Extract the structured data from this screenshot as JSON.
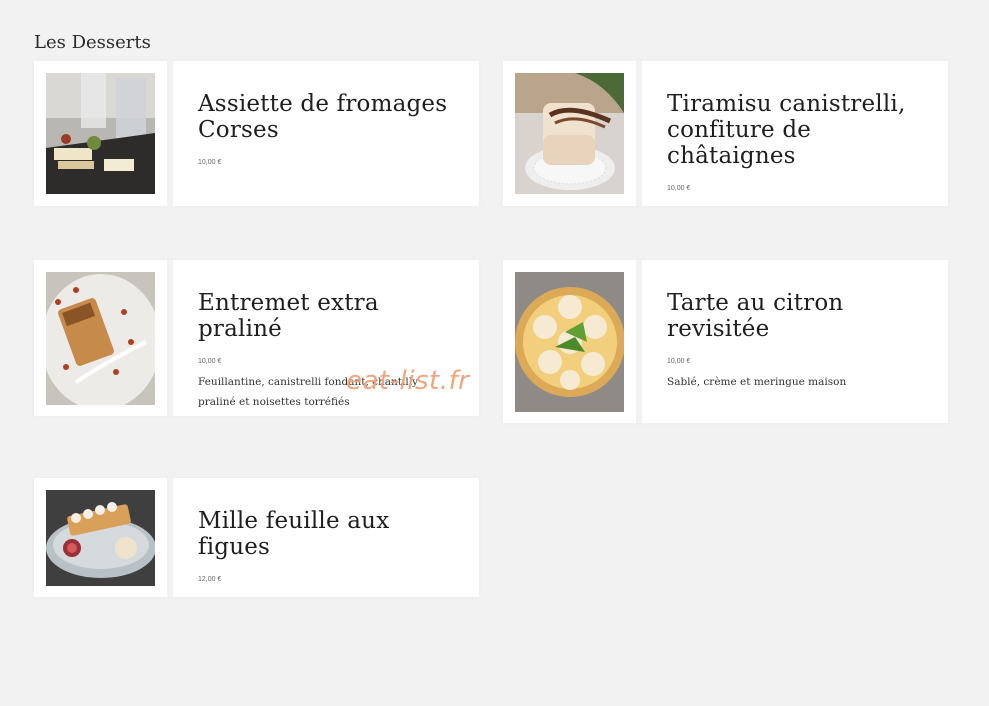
{
  "section": {
    "title": "Les Desserts"
  },
  "items": [
    {
      "name": "Assiette de fromages Corses",
      "price": "10,00 €",
      "description": ""
    },
    {
      "name": "Tiramisu canistrelli, confiture de châtaignes",
      "price": "10,00 €",
      "description": ""
    },
    {
      "name": "Entremet extra praliné",
      "price": "10,00 €",
      "description": "Feuillantine, canistrelli fondant, chantilly praliné et noisettes torréfiés"
    },
    {
      "name": "Tarte au citron revisitée",
      "price": "10,00 €",
      "description": "Sablé, crème et meringue maison"
    },
    {
      "name": "Mille feuille aux figues",
      "price": "12,00 €",
      "description": ""
    }
  ],
  "watermark": "eat-list.fr",
  "colors": {
    "background": "#f2f2f2",
    "card": "#ffffff",
    "watermark": "#f0a67a"
  }
}
